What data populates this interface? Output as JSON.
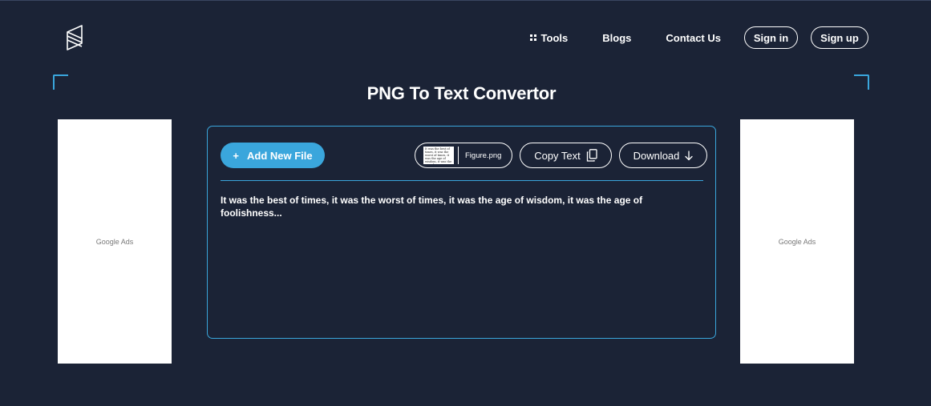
{
  "header": {
    "logo_icon": "stacked-layers-logo-icon",
    "nav": {
      "tools_label": "Tools",
      "tools_icon": "grid-icon",
      "blogs_label": "Blogs",
      "contact_label": "Contact Us"
    },
    "auth": {
      "signin_label": "Sign in",
      "signup_label": "Sign up"
    }
  },
  "page": {
    "title": "PNG To Text Convertor"
  },
  "ads": {
    "left_label": "Google Ads",
    "right_label": "Google Ads"
  },
  "converter": {
    "add_file_label": "Add New File",
    "add_file_icon": "plus-icon",
    "file": {
      "name": "Figure.png",
      "thumbnail_text": "It was the best of times, it was the worst of times, it was the age of wisdom, it was the age of foolishness..."
    },
    "copy_label": "Copy Text",
    "copy_icon": "copy-icon",
    "download_label": "Download",
    "download_icon": "arrow-down-icon",
    "output_text": "It was the best of times, it was the worst of times, it was the age of wisdom, it was the age of foolishness..."
  },
  "colors": {
    "background": "#1b2336",
    "accent": "#3aa6dc",
    "ad_background": "#ffffff"
  }
}
